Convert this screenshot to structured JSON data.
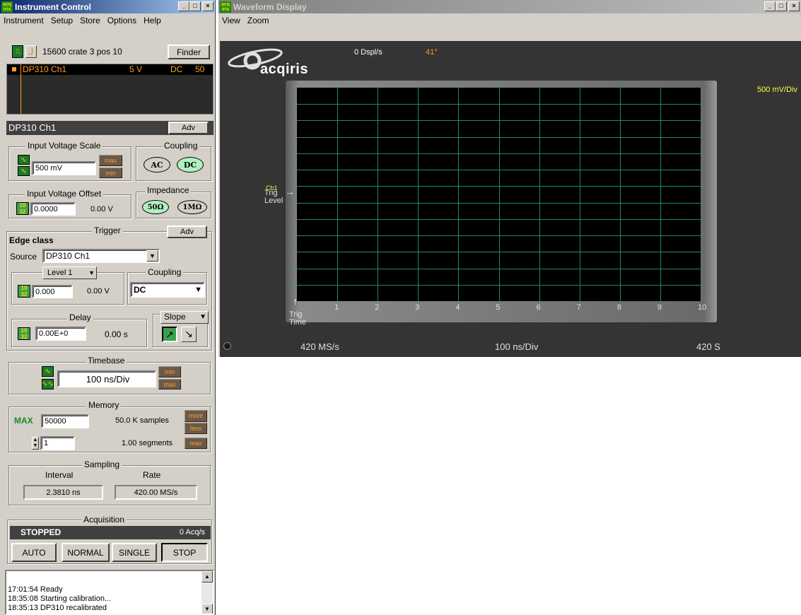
{
  "instrument": {
    "title": "Instrument Control",
    "menu": [
      "Instrument",
      "Setup",
      "Store",
      "Options",
      "Help"
    ],
    "device": "15600 crate 3 pos 10",
    "finder": "Finder",
    "channel_list": {
      "name": "DP310 Ch1",
      "volts": "5 V",
      "coupling": "DC",
      "impedance": "50"
    },
    "selected_channel": "DP310 Ch1",
    "adv": "Adv",
    "input_scale": {
      "label": "Input Voltage Scale",
      "value": "500 mV",
      "max": "max",
      "min": "min"
    },
    "coupling": {
      "label": "Coupling",
      "ac": "AC",
      "dc": "DC"
    },
    "input_offset": {
      "label": "Input Voltage Offset",
      "value": "0.0000",
      "readout": "0.00 V"
    },
    "impedance": {
      "label": "Impedance",
      "low": "50Ω",
      "high": "1MΩ"
    },
    "trigger": {
      "label": "Trigger",
      "adv": "Adv",
      "class": "Edge class",
      "source_label": "Source",
      "source": "DP310 Ch1",
      "level_select": "Level 1",
      "level_value": "0.000",
      "level_readout": "0.00 V",
      "coupling_label": "Coupling",
      "coupling": "DC",
      "delay_label": "Delay",
      "delay_value": "0.00E+0",
      "delay_readout": "0.00 s",
      "slope_label": "Slope"
    },
    "timebase": {
      "label": "Timebase",
      "value": "100 ns/Div",
      "min": "min",
      "max": "max"
    },
    "memory": {
      "label": "Memory",
      "max_label": "MAX",
      "samples_value": "50000",
      "samples_readout": "50.0 K  samples",
      "segments_value": "1",
      "segments_readout": "1.00  segments",
      "more": "more",
      "less": "less",
      "max": "max"
    },
    "sampling": {
      "label": "Sampling",
      "interval_label": "Interval",
      "rate_label": "Rate",
      "interval": "2.3810 ns",
      "rate": "420.00 MS/s"
    },
    "acquisition": {
      "label": "Acquisition",
      "status": "STOPPED",
      "rate": "0 Acq/s",
      "buttons": [
        "AUTO",
        "NORMAL",
        "SINGLE",
        "STOP"
      ]
    },
    "log": [
      "17:01:54 Ready",
      "18:35:08 Starting calibration...",
      "18:35:13 DP310 recalibrated"
    ]
  },
  "waveform": {
    "title": "Waveform Display",
    "menu": [
      "View",
      "Zoom"
    ],
    "logo": "acqiris",
    "dspl_rate": "0 Dspl/s",
    "temp": "41°",
    "vdiv": "500 mV/Div",
    "trig_level_label": "Trig\nLevel",
    "ch_marker": "Ch1",
    "x_ticks": [
      "1",
      "2",
      "3",
      "4",
      "5",
      "6",
      "7",
      "8",
      "9",
      "10"
    ],
    "trig_time_label": "Trig\nTime",
    "sample_rate": "420 MS/s",
    "timebase": "100 ns/Div",
    "points": "420 S"
  },
  "colors": {
    "grid": "#1f8a6a",
    "orange": "#ffa020",
    "yellow": "#ffff40",
    "title_active": "#0a246a"
  }
}
